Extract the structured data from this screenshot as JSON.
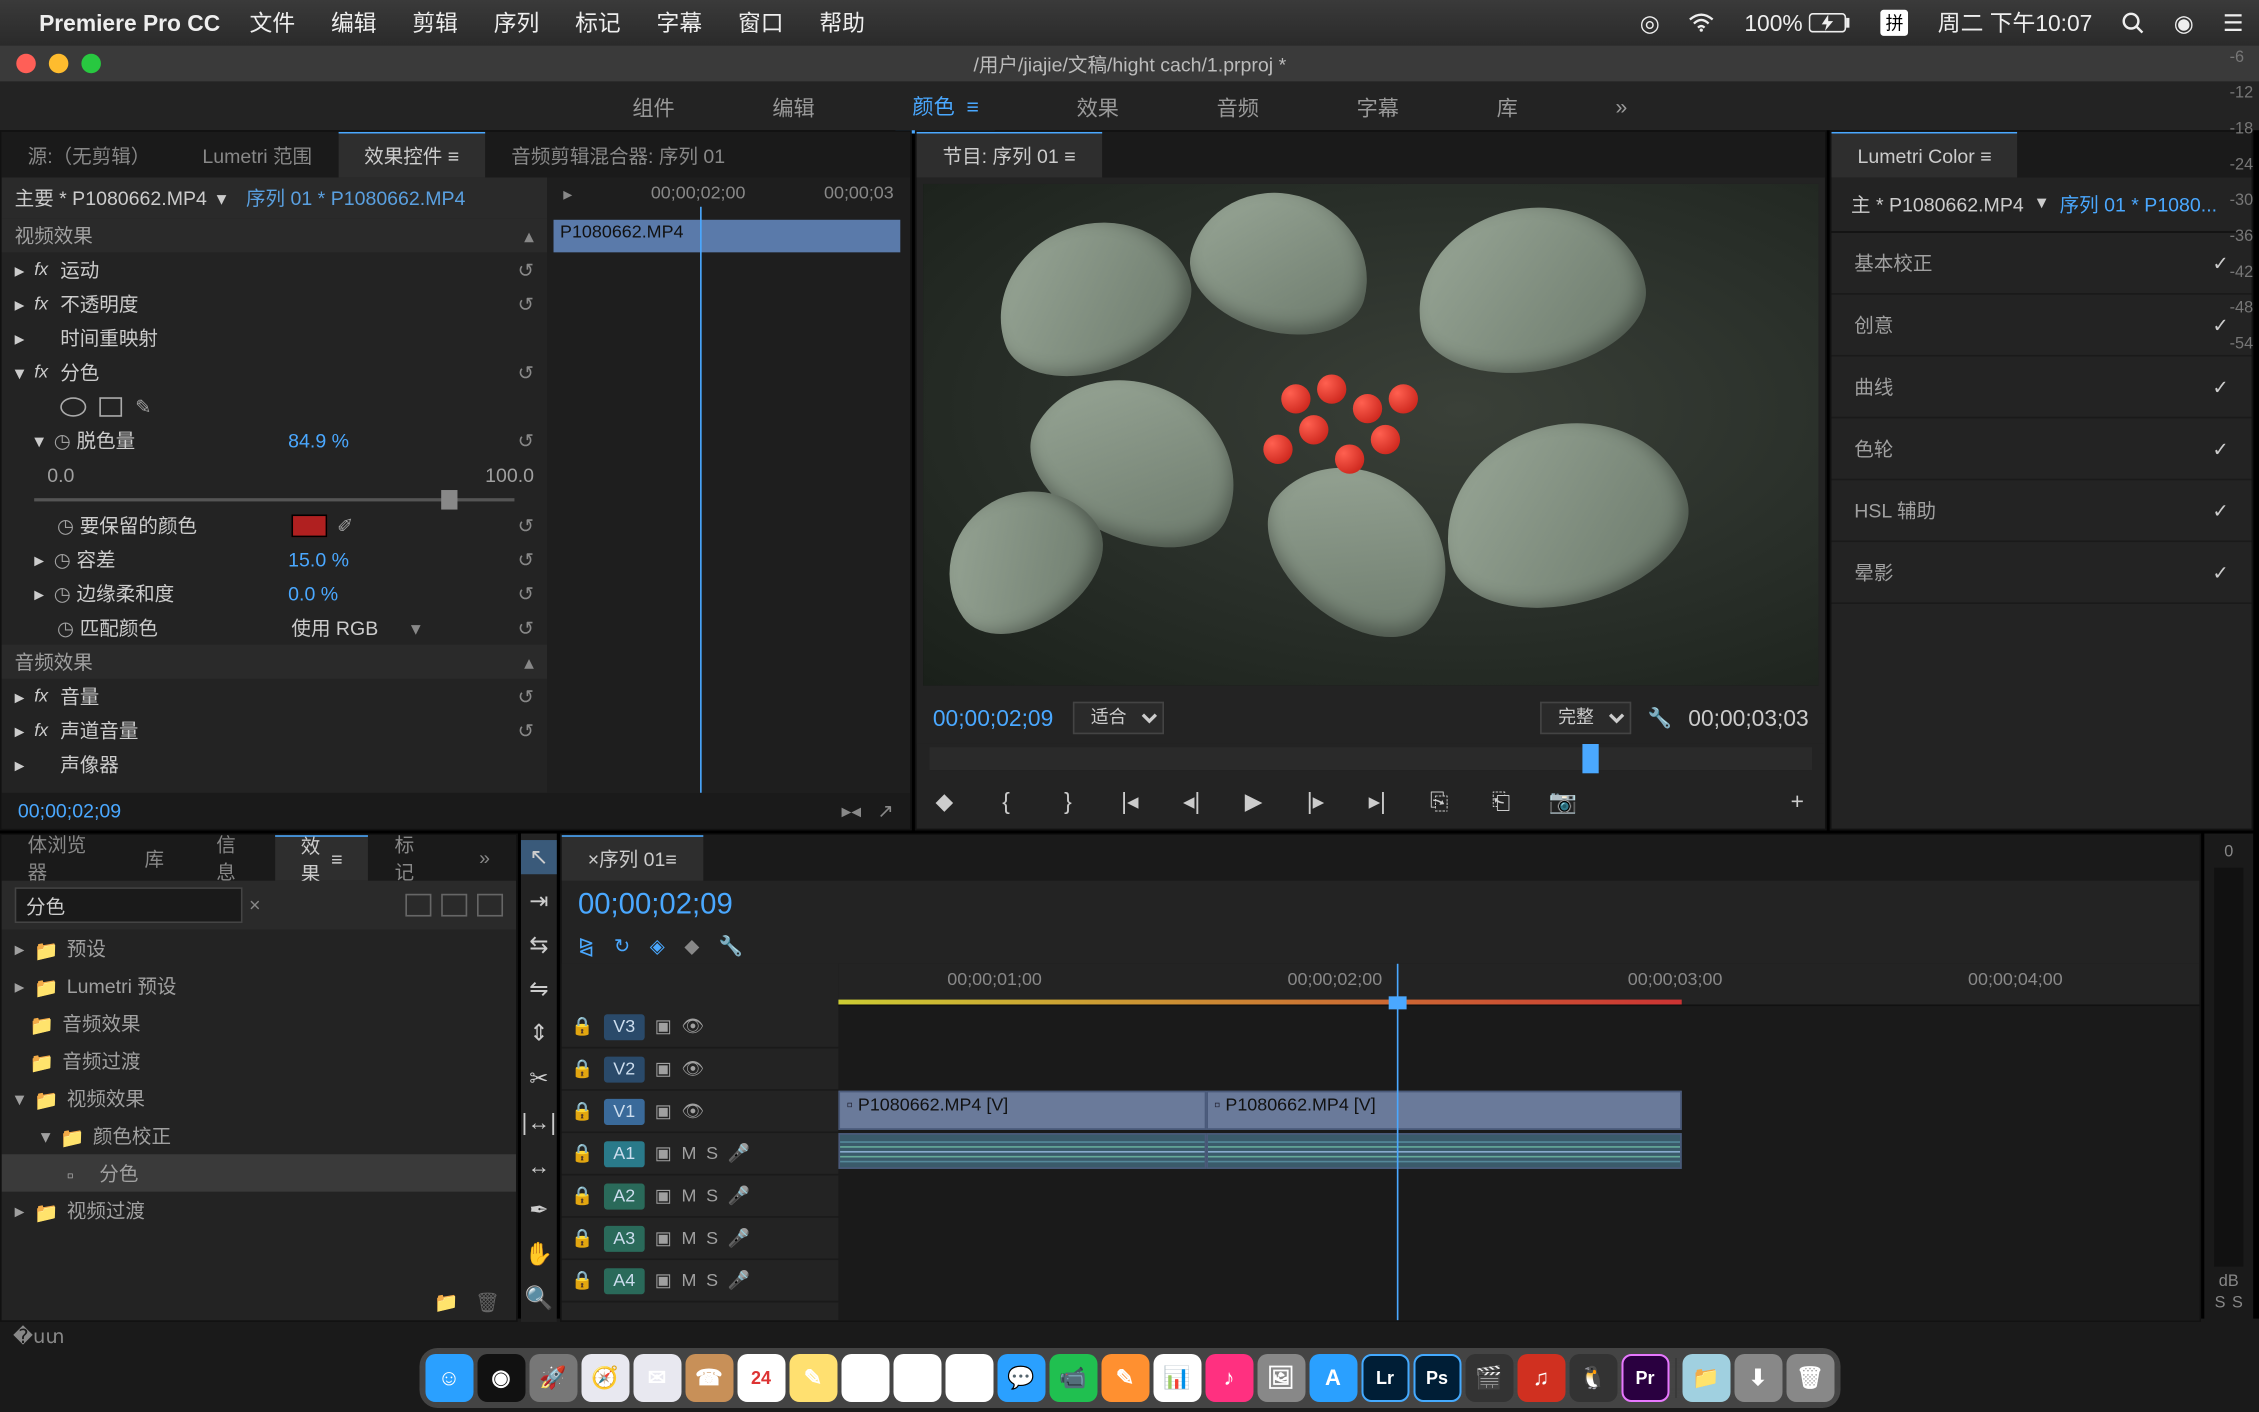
{
  "menubar": {
    "app_name": "Premiere Pro CC",
    "items": [
      "文件",
      "编辑",
      "剪辑",
      "序列",
      "标记",
      "字幕",
      "窗口",
      "帮助"
    ],
    "battery": "100%",
    "input_method": "拼",
    "clock": "周二 下午10:07"
  },
  "titlebar": {
    "path": "/用户/jiajie/文稿/hight cach/1.prproj *"
  },
  "workspaces": {
    "items": [
      "组件",
      "编辑",
      "颜色",
      "效果",
      "音频",
      "字幕",
      "库"
    ],
    "active": "颜色",
    "overflow": "»"
  },
  "source_panel": {
    "tabs": [
      "源:（无剪辑）",
      "Lumetri 范围",
      "效果控件",
      "音频剪辑混合器: 序列 01"
    ],
    "active_tab": "效果控件",
    "master_label": "主要 * P1080662.MP4",
    "sequence_label": "序列 01 * P1080662.MP4",
    "mini_tl_start": "00;00;02;00",
    "mini_tl_end": "00;00;03",
    "mini_clip": "P1080662.MP4",
    "section_video": "视频效果",
    "fx_motion": "运动",
    "fx_opacity": "不透明度",
    "fx_timeremap": "时间重映射",
    "fx_leave_color": "分色",
    "params": {
      "amount_label": "脱色量",
      "amount_val": "84.9 %",
      "slider_min": "0.0",
      "slider_max": "100.0",
      "color_label": "要保留的颜色",
      "tolerance_label": "容差",
      "tolerance_val": "15.0 %",
      "edge_label": "边缘柔和度",
      "edge_val": "0.0 %",
      "match_label": "匹配颜色",
      "match_val": "使用 RGB"
    },
    "section_audio": "音频效果",
    "fx_volume": "音量",
    "fx_chvolume": "声道音量",
    "fx_panner": "声像器",
    "timecode": "00;00;02;09"
  },
  "program": {
    "tab": "节目: 序列 01",
    "tc": "00;00;02;09",
    "fit": "适合",
    "res": "完整",
    "duration": "00;00;03;03"
  },
  "lumetri": {
    "title": "Lumetri Color",
    "master": "主 * P1080662.MP4",
    "seq": "序列 01 * P1080...",
    "sections": [
      "基本校正",
      "创意",
      "曲线",
      "色轮",
      "HSL 辅助",
      "晕影"
    ]
  },
  "effects_browser": {
    "tabs": [
      "体浏览器",
      "库",
      "信息",
      "效果",
      "标记"
    ],
    "active_tab": "效果",
    "overflow": "»",
    "search": "分色",
    "tree": [
      {
        "label": "预设",
        "depth": 0
      },
      {
        "label": "Lumetri 预设",
        "depth": 0
      },
      {
        "label": "音频效果",
        "depth": 0
      },
      {
        "label": "音频过渡",
        "depth": 0
      },
      {
        "label": "视频效果",
        "depth": 0,
        "open": true
      },
      {
        "label": "颜色校正",
        "depth": 1,
        "open": true
      },
      {
        "label": "分色",
        "depth": 2,
        "leaf": true,
        "sel": true
      },
      {
        "label": "视频过渡",
        "depth": 0
      }
    ]
  },
  "timeline": {
    "tab": "序列 01",
    "tc": "00;00;02;09",
    "ruler": [
      "00;00;01;00",
      "00;00;02;00",
      "00;00;03;00",
      "00;00;04;00"
    ],
    "video_tracks": [
      "V3",
      "V2",
      "V1"
    ],
    "audio_tracks": [
      "A1",
      "A2",
      "A3",
      "A4"
    ],
    "clip_v1a": "P1080662.MP4 [V]",
    "clip_v1b": "P1080662.MP4 [V]"
  },
  "meter": {
    "ticks": [
      "0",
      "-6",
      "-12",
      "-18",
      "-24",
      "-30",
      "-36",
      "-42",
      "-48",
      "-54"
    ],
    "unit": "dB",
    "solo": "S"
  },
  "dock": {
    "apps": [
      {
        "name": "finder",
        "bg": "#2aa0ff",
        "txt": "☺"
      },
      {
        "name": "siri",
        "bg": "#111",
        "txt": "◉"
      },
      {
        "name": "launchpad",
        "bg": "#777",
        "txt": "🚀"
      },
      {
        "name": "safari",
        "bg": "#e8e8f0",
        "txt": "🧭"
      },
      {
        "name": "mail",
        "bg": "#e8e8f0",
        "txt": "✉"
      },
      {
        "name": "contacts",
        "bg": "#c89058",
        "txt": "☎"
      },
      {
        "name": "calendar",
        "bg": "#fff",
        "txt": "24"
      },
      {
        "name": "notes",
        "bg": "#ffe070",
        "txt": "✎"
      },
      {
        "name": "reminders",
        "bg": "#fff",
        "txt": "☑"
      },
      {
        "name": "maps",
        "bg": "#fff",
        "txt": "🗺"
      },
      {
        "name": "photos",
        "bg": "#fff",
        "txt": "✿"
      },
      {
        "name": "messages",
        "bg": "#2aa0ff",
        "txt": "💬"
      },
      {
        "name": "facetime",
        "bg": "#20c050",
        "txt": "📹"
      },
      {
        "name": "pages",
        "bg": "#ff9030",
        "txt": "✎"
      },
      {
        "name": "numbers",
        "bg": "#fff",
        "txt": "📊"
      },
      {
        "name": "itunes",
        "bg": "#ff3080",
        "txt": "♪"
      },
      {
        "name": "preview",
        "bg": "#888",
        "txt": "🖼"
      },
      {
        "name": "appstore",
        "bg": "#2aa0ff",
        "txt": "A"
      },
      {
        "name": "lightroom",
        "bg": "#001e36",
        "txt": "Lr"
      },
      {
        "name": "photoshop",
        "bg": "#001e36",
        "txt": "Ps"
      },
      {
        "name": "fcpx",
        "bg": "#333",
        "txt": "🎬"
      },
      {
        "name": "netease",
        "bg": "#d03020",
        "txt": "♫"
      },
      {
        "name": "qq",
        "bg": "#333",
        "txt": "🐧"
      },
      {
        "name": "premiere",
        "bg": "#2a0040",
        "txt": "Pr"
      },
      {
        "name": "files",
        "bg": "#a0d0e0",
        "txt": "📁"
      },
      {
        "name": "downloads",
        "bg": "#888",
        "txt": "⬇"
      },
      {
        "name": "trash",
        "bg": "#888",
        "txt": "🗑"
      }
    ]
  }
}
